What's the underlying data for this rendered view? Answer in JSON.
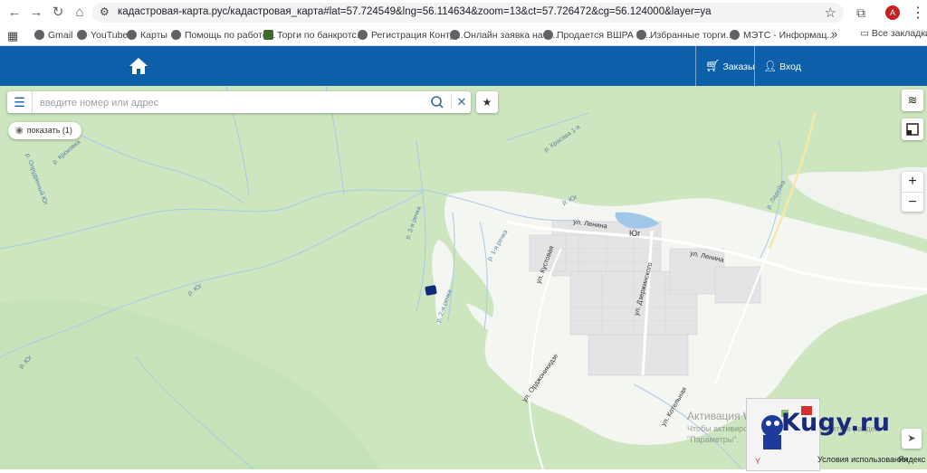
{
  "browser": {
    "url": "кадастровая-карта.рус/кадастровая_карта#lat=57.724549&lng=56.114634&zoom=13&ct=57.726472&cg=56.124000&layer=ya",
    "avatar_letter": "A",
    "bookmarks": [
      {
        "label": "Gmail"
      },
      {
        "label": "YouTube"
      },
      {
        "label": "Карты"
      },
      {
        "label": "Помощь по работе..."
      },
      {
        "label": "Торги по банкротс..."
      },
      {
        "label": "Регистрация Контр..."
      },
      {
        "label": "Онлайн заявка на з..."
      },
      {
        "label": "Продается ВШРА П..."
      },
      {
        "label": "Избранные торги..."
      },
      {
        "label": "МЭТС - Информац..."
      }
    ],
    "more_bookmarks": "»",
    "all_bookmarks": "Все закладки"
  },
  "site": {
    "orders_label": "Заказы",
    "login_label": "Вход",
    "brand_color": "#0c5fa8"
  },
  "search": {
    "placeholder": "введите номер или адрес"
  },
  "show_pill": "показать (1)",
  "map": {
    "town_label": "Юг",
    "streets": [
      "ул. Ленина",
      "ул. Ленина",
      "ул. Дзержинского",
      "ул. Кустовая",
      "ул. Орджоникидзе",
      "ул. Котельная"
    ],
    "rivers": [
      "р. Кроковка",
      "р. Опрудянный Юг",
      "р. Юг",
      "р. Юг",
      "р. Юг",
      "р. Красава 1-я",
      "р. 3-я речка",
      "р. 2-я речка",
      "р. 1-я речка",
      "р. Ладейка"
    ],
    "zoom_in": "+",
    "zoom_out": "−"
  },
  "overlay": {
    "watermark_title": "Активация Windows",
    "watermark_sub1": "Чтобы активировать Windows, перейдите в раздел",
    "watermark_sub2": "\"Параметры\".",
    "kugy_text": "Kugy.ru",
    "terms": "Условия использования",
    "yandex": "Яндекс"
  }
}
